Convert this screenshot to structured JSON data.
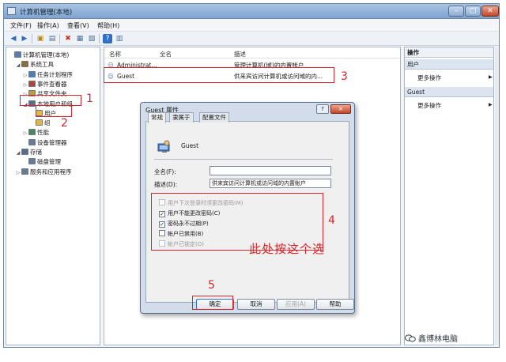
{
  "window": {
    "title": "计算机管理(本地)"
  },
  "menu": [
    "文件(F)",
    "操作(A)",
    "查看(V)",
    "帮助(H)"
  ],
  "tree": [
    {
      "label": "计算机管理(本地)",
      "indent": 0,
      "twisty": ""
    },
    {
      "label": "系统工具",
      "indent": 1,
      "twisty": "◢"
    },
    {
      "label": "任务计划程序",
      "indent": 2,
      "twisty": "▷"
    },
    {
      "label": "事件查看器",
      "indent": 2,
      "twisty": "▷"
    },
    {
      "label": "共享文件夹",
      "indent": 2,
      "twisty": "▷"
    },
    {
      "label": "本地用户和组",
      "indent": 2,
      "twisty": "◢"
    },
    {
      "label": "用户",
      "indent": 3,
      "twisty": ""
    },
    {
      "label": "组",
      "indent": 3,
      "twisty": ""
    },
    {
      "label": "性能",
      "indent": 2,
      "twisty": "▷"
    },
    {
      "label": "设备管理器",
      "indent": 2,
      "twisty": ""
    },
    {
      "label": "存储",
      "indent": 1,
      "twisty": "◢"
    },
    {
      "label": "磁盘管理",
      "indent": 2,
      "twisty": ""
    },
    {
      "label": "服务和应用程序",
      "indent": 1,
      "twisty": "▷"
    }
  ],
  "list": {
    "columns": [
      "名称",
      "全名",
      "描述"
    ],
    "rows": [
      {
        "name": "Administrat...",
        "full": "",
        "desc": "管理计算机(域)的内置帐户"
      },
      {
        "name": "Guest",
        "full": "",
        "desc": "供来宾访问计算机或访问域的内..."
      }
    ]
  },
  "actions": {
    "title": "操作",
    "sections": [
      {
        "head": "用户",
        "item": "更多操作"
      },
      {
        "head": "Guest",
        "item": "更多操作"
      }
    ]
  },
  "dialog": {
    "title": "Guest 属性",
    "help": "?",
    "close": "×",
    "tabs": [
      "常规",
      "隶属于",
      "配置文件"
    ],
    "username": "Guest",
    "fullname_label": "全名(F):",
    "fullname_value": "",
    "desc_label": "描述(D):",
    "desc_value": "供来宾访问计算机或访问域的内置帐户",
    "checks": [
      {
        "label": "用户下次登录时须更改密码(M)",
        "checked": false,
        "disabled": true
      },
      {
        "label": "用户不能更改密码(C)",
        "checked": true,
        "disabled": false
      },
      {
        "label": "密码永不过期(P)",
        "checked": true,
        "disabled": false
      },
      {
        "label": "帐户已禁用(B)",
        "checked": false,
        "disabled": false
      },
      {
        "label": "帐户已锁定(O)",
        "checked": false,
        "disabled": true
      }
    ],
    "hint": "此处按这个选",
    "buttons": {
      "ok": "确定",
      "cancel": "取消",
      "apply": "应用(A)",
      "help": "帮助"
    }
  },
  "annotations": [
    "1",
    "2",
    "3",
    "4",
    "5"
  ],
  "watermark": "鑫博林电脑",
  "colors": {
    "annotation": "#d6262c",
    "title_bar": "#8fb0d8"
  }
}
